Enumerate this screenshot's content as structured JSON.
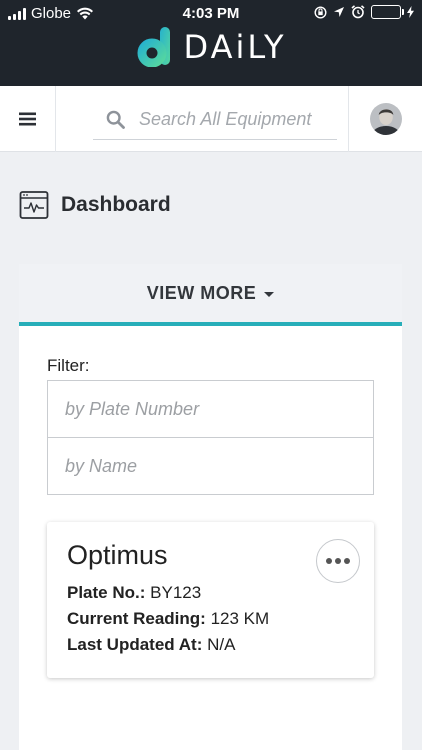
{
  "status_bar": {
    "carrier": "Globe",
    "time": "4:03 PM",
    "battery_level": 1.0,
    "icons": [
      "signal-icon",
      "wifi-icon",
      "lock-rotation-icon",
      "location-icon",
      "alarm-icon",
      "battery-icon",
      "charging-icon"
    ]
  },
  "brand": {
    "name": "DAiLY",
    "logo_colors": [
      "#2bb5c8",
      "#4fd1a5"
    ]
  },
  "navbar": {
    "menu_icon": "hamburger-menu-icon",
    "search_icon": "search-icon",
    "search_placeholder": "Search All Equipment",
    "avatar_icon": "user-avatar"
  },
  "dashboard": {
    "title": "Dashboard",
    "icon": "monitor-pulse-icon",
    "view_more_label": "VIEW MORE"
  },
  "filter": {
    "label": "Filter:",
    "plate_placeholder": "by Plate Number",
    "name_placeholder": "by Name"
  },
  "equipment": [
    {
      "name": "Optimus",
      "plate_label": "Plate No.:",
      "plate_value": "BY123",
      "reading_label": "Current Reading:",
      "reading_value": "123 KM",
      "updated_label": "Last Updated At:",
      "updated_value": "N/A"
    }
  ],
  "colors": {
    "header_bg": "#1f252c",
    "accent": "#27aeb9",
    "page_bg": "#eef0f3"
  }
}
